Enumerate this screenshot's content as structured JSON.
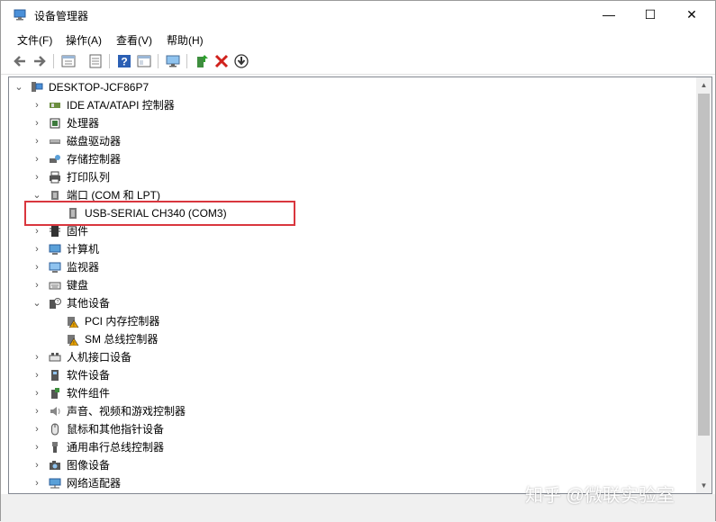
{
  "window": {
    "title": "设备管理器"
  },
  "window_controls": {
    "minimize": "—",
    "maximize": "☐",
    "close": "✕"
  },
  "menu": [
    "文件(F)",
    "操作(A)",
    "查看(V)",
    "帮助(H)"
  ],
  "toolbar_icons": [
    "back-icon",
    "forward-icon",
    "properties-icon",
    "list-icon",
    "help-icon",
    "view-icon",
    "monitor-scan-icon",
    "update-driver-icon",
    "uninstall-icon",
    "download-icon"
  ],
  "tree": {
    "root": "DESKTOP-JCF86P7",
    "items": [
      {
        "label": "IDE ATA/ATAPI 控制器",
        "icon": "ide-controller-icon",
        "expanded": false
      },
      {
        "label": "处理器",
        "icon": "processor-icon",
        "expanded": false
      },
      {
        "label": "磁盘驱动器",
        "icon": "disk-drive-icon",
        "expanded": false
      },
      {
        "label": "存储控制器",
        "icon": "storage-controller-icon",
        "expanded": false
      },
      {
        "label": "打印队列",
        "icon": "printer-icon",
        "expanded": false
      },
      {
        "label": "端口 (COM 和 LPT)",
        "icon": "port-icon",
        "expanded": true,
        "children": [
          {
            "label": "USB-SERIAL CH340 (COM3)",
            "icon": "serial-port-icon"
          }
        ]
      },
      {
        "label": "固件",
        "icon": "firmware-icon",
        "expanded": false
      },
      {
        "label": "计算机",
        "icon": "computer-icon",
        "expanded": false
      },
      {
        "label": "监视器",
        "icon": "monitor-icon",
        "expanded": false
      },
      {
        "label": "键盘",
        "icon": "keyboard-icon",
        "expanded": false
      },
      {
        "label": "其他设备",
        "icon": "other-devices-icon",
        "expanded": true,
        "children": [
          {
            "label": "PCI 内存控制器",
            "icon": "warning-device-icon"
          },
          {
            "label": "SM 总线控制器",
            "icon": "warning-device-icon"
          }
        ]
      },
      {
        "label": "人机接口设备",
        "icon": "hid-icon",
        "expanded": false
      },
      {
        "label": "软件设备",
        "icon": "software-device-icon",
        "expanded": false
      },
      {
        "label": "软件组件",
        "icon": "software-component-icon",
        "expanded": false
      },
      {
        "label": "声音、视频和游戏控制器",
        "icon": "sound-icon",
        "expanded": false
      },
      {
        "label": "鼠标和其他指针设备",
        "icon": "mouse-icon",
        "expanded": false
      },
      {
        "label": "通用串行总线控制器",
        "icon": "usb-icon",
        "expanded": false
      },
      {
        "label": "图像设备",
        "icon": "camera-icon",
        "expanded": false
      },
      {
        "label": "网络适配器",
        "icon": "network-icon",
        "expanded": false
      }
    ]
  },
  "watermark": "知乎 @微联实验室",
  "colors": {
    "highlight": "#d9363e",
    "accent": "#2b7cd3",
    "warning": "#e8a200"
  }
}
